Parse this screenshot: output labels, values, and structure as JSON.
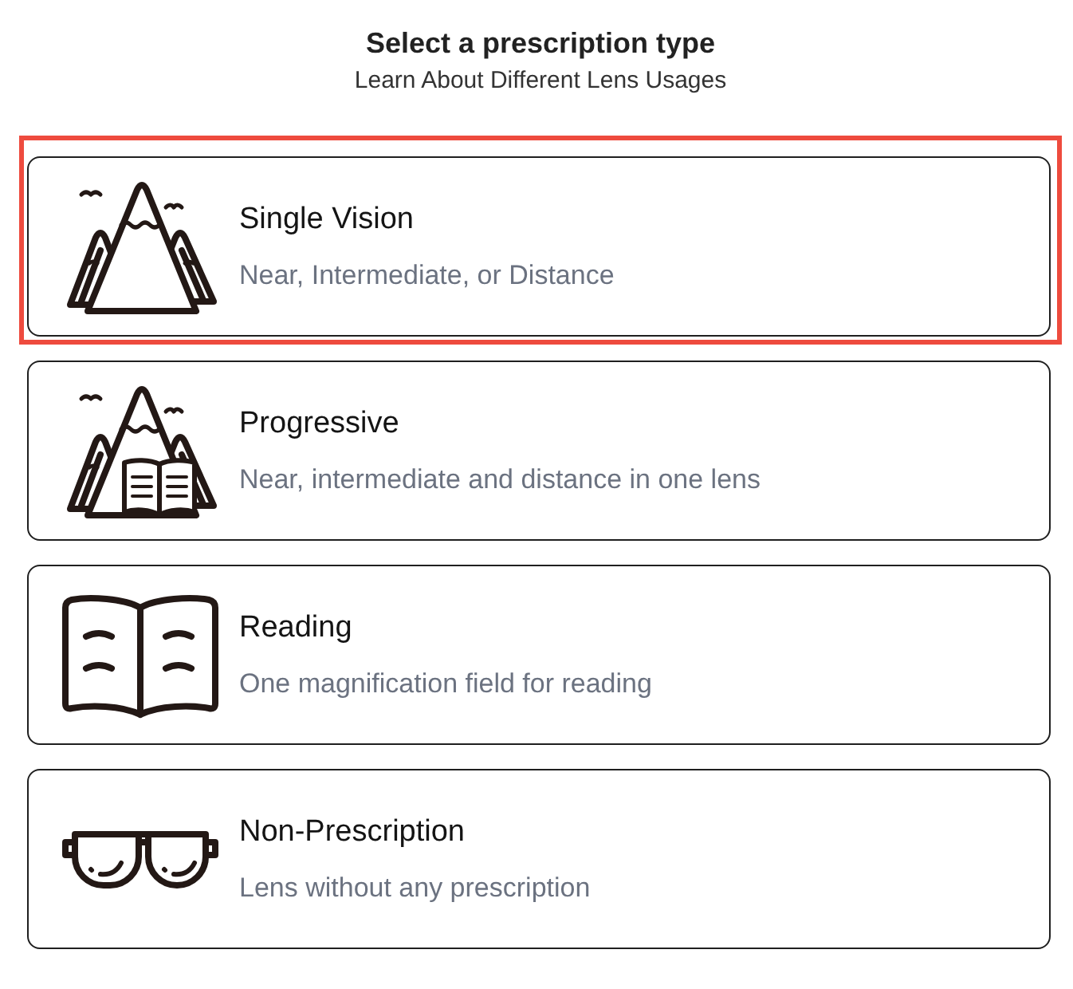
{
  "header": {
    "title": "Select a prescription type",
    "subtitle": "Learn About Different Lens Usages"
  },
  "options": [
    {
      "kind": "single-vision",
      "title": "Single Vision",
      "description": "Near, Intermediate, or Distance",
      "selected": true
    },
    {
      "kind": "progressive",
      "title": "Progressive",
      "description": "Near, intermediate and distance in one lens",
      "selected": false
    },
    {
      "kind": "reading",
      "title": "Reading",
      "description": "One magnification field for reading",
      "selected": false
    },
    {
      "kind": "non-prescription",
      "title": "Non-Prescription",
      "description": "Lens without any prescription",
      "selected": false
    }
  ]
}
